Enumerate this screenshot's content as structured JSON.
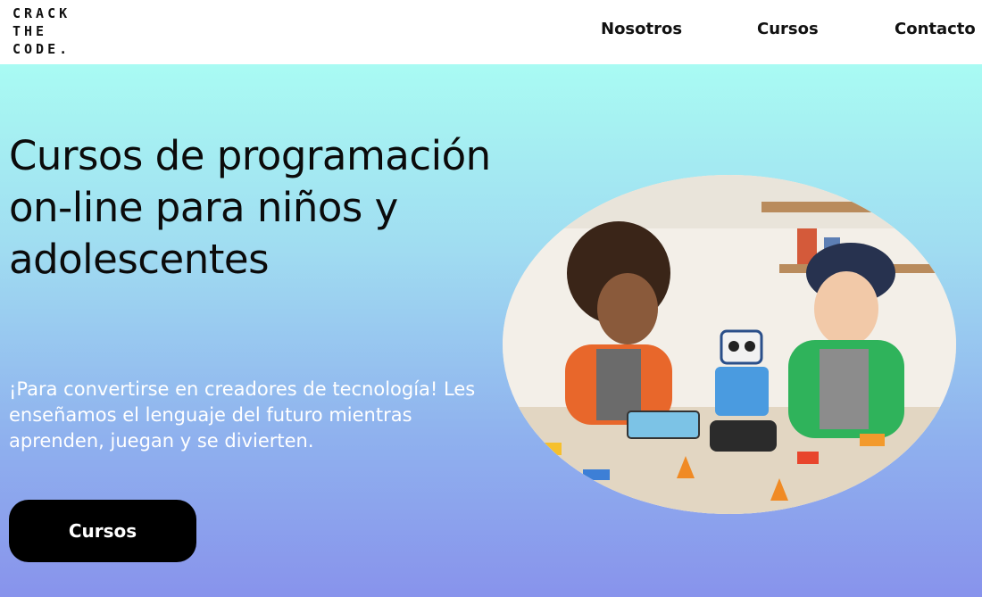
{
  "header": {
    "logo_lines": [
      "CRACK",
      "THE",
      "CODE."
    ],
    "nav": [
      {
        "label": "Nosotros"
      },
      {
        "label": "Cursos"
      },
      {
        "label": "Contacto"
      }
    ]
  },
  "hero": {
    "title": "Cursos de programación on-line para niños y adolescentes",
    "description": "¡Para convertirse en creadores de tecnología! Les enseñamos el lenguaje del futuro mientras aprenden, juegan y se divierten.",
    "cta_label": "Cursos"
  },
  "colors": {
    "gradient_top": "#a9fbf3",
    "gradient_bottom": "#8893ec",
    "cta_bg": "#000000",
    "cta_text": "#ffffff"
  }
}
